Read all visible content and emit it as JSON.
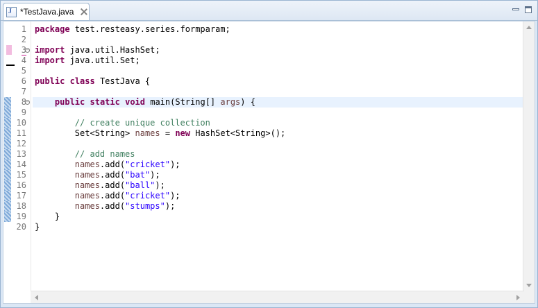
{
  "tab": {
    "title": "*TestJava.java",
    "icon": "java-file-icon",
    "close_icon": "close-icon"
  },
  "window": {
    "minimize_icon": "minimize-icon",
    "maximize_icon": "maximize-icon"
  },
  "editor": {
    "line_numbers": [
      "1",
      "2",
      "3",
      "4",
      "5",
      "6",
      "7",
      "8",
      "9",
      "10",
      "11",
      "12",
      "13",
      "14",
      "15",
      "16",
      "17",
      "18",
      "19",
      "20"
    ],
    "code": {
      "l1_kw": "package",
      "l1_rest": " test.resteasy.series.formparam;",
      "l3_kw": "import",
      "l3_rest": " java.util.HashSet;",
      "l4_kw": "import",
      "l4_rest": " java.util.Set;",
      "l6_kw1": "public",
      "l6_kw2": "class",
      "l6_rest": " TestJava {",
      "l8_kw1": "public",
      "l8_kw2": "static",
      "l8_kw3": "void",
      "l8_mid": " main(String[] ",
      "l8_param": "args",
      "l8_end": ") {",
      "l10_comment": "// create unique collection",
      "l11_a": "Set<String> ",
      "l11_var": "names",
      "l11_b": " = ",
      "l11_kw": "new",
      "l11_c": " HashSet<String>();",
      "l13_comment": "// add names",
      "add_prefix": "names",
      "add_call": ".add(",
      "add_end": ");",
      "s14": "\"cricket\"",
      "s15": "\"bat\"",
      "s16": "\"ball\"",
      "s17": "\"cricket\"",
      "s18": "\"stumps\"",
      "l19": "}",
      "l20": "}"
    }
  },
  "colors": {
    "keyword": "#7f0055",
    "comment": "#3f7f5f",
    "string": "#2a00ff",
    "highlight_line": "#e8f2fe"
  }
}
